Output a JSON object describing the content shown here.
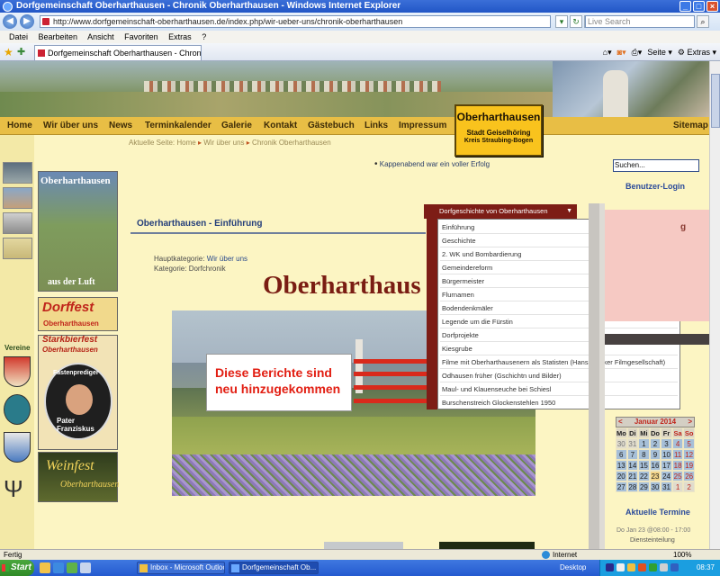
{
  "window": {
    "title": "Dorfgemeinschaft Oberharthausen - Chronik Oberharthausen - Windows Internet Explorer",
    "url": "http://www.dorfgemeinschaft-oberharthausen.de/index.php/wir-ueber-uns/chronik-oberharthausen",
    "live_search_placeholder": "Live Search",
    "tab_title": "Dorfgemeinschaft Oberharthausen - Chronik Oberhar...",
    "tools": {
      "seite": "Seite",
      "extras": "Extras"
    },
    "icons": [
      "ie-icon",
      "back-icon",
      "forward-icon",
      "refresh-icon",
      "stop-icon",
      "search-icon",
      "favorites-star-icon",
      "add-favorites-icon",
      "home-icon",
      "feeds-icon",
      "print-icon"
    ]
  },
  "menu": [
    "Datei",
    "Bearbeiten",
    "Ansicht",
    "Favoriten",
    "Extras",
    "?"
  ],
  "site": {
    "nav": [
      "Home",
      "Wir über uns",
      "News",
      "Terminkalender",
      "Galerie",
      "Kontakt",
      "Gästebuch",
      "Links",
      "Impressum"
    ],
    "sitemap": "Sitemap",
    "logo": {
      "line1": "Oberharthausen",
      "line2": "Stadt Geiselhöring",
      "line3": "Kreis Straubing-Bogen"
    },
    "breadcrumb": {
      "prefix": "Aktuelle Seite: ",
      "home": "Home",
      "level1": "Wir über uns",
      "level2": "Chronik Oberharthausen"
    },
    "news_item": "Kappenabend war ein voller Erfolg",
    "left": {
      "vereine": "Vereine"
    },
    "ads": {
      "luft_title": "Oberharthausen",
      "luft_sub": "aus der Luft",
      "dorffest_title": "Dorffest",
      "dorffest_sub": "Oberharthausen",
      "starkbier_title": "Starkbierfest",
      "starkbier_sub": "Oberharthausen",
      "fasten_top": "Fastenprediger",
      "fasten_bottom": "Pater Franziskus",
      "weinfest_title": "Weinfest",
      "weinfest_sub": "Oberharthausen"
    },
    "section_title": "Oberharthausen - Einführung",
    "hauptkategorie_label": "Hauptkategorie: ",
    "hauptkategorie_link": "Wir über uns",
    "kategorie": "Kategorie: Dorfchronik",
    "big_title": "Oberharthaus",
    "annotation": {
      "line1": "Diese Berichte sind",
      "line2": "neu hinzugekommen"
    },
    "dropdown": {
      "header": "Dorfgeschichte von Oberharthausen",
      "items": [
        "Einführung",
        "Geschichte",
        "2. WK und Bombardierung",
        "Gemeindereform",
        "Bürgermeister",
        "Flurnamen",
        "Bodendenkmäler",
        "Legende um die Fürstin",
        "Dorfprojekte",
        "Kiesgrube",
        "Filme mit Oberharthausenern als Statisten (Hans Wacker Filmgesellschaft)",
        "Odhausen früher (Gschichtn und Bilder)",
        "Maul- und Klauenseuche bei Schiesl",
        "Burschenstreich Glockenstehlen 1950"
      ]
    },
    "right": {
      "search_value": "Suchen...",
      "login": "Benutzer-Login",
      "pink_glyph": "g",
      "calendar": {
        "month": "Januar 2014",
        "prev": "<",
        "next": ">",
        "weekdays": [
          "Mo",
          "Di",
          "Mi",
          "Do",
          "Fr",
          "Sa",
          "So"
        ],
        "weeks": [
          [
            "30",
            "31",
            "1",
            "2",
            "3",
            "4",
            "5"
          ],
          [
            "6",
            "7",
            "8",
            "9",
            "10",
            "11",
            "12"
          ],
          [
            "13",
            "14",
            "15",
            "16",
            "17",
            "18",
            "19"
          ],
          [
            "20",
            "21",
            "22",
            "23",
            "24",
            "25",
            "26"
          ],
          [
            "27",
            "28",
            "29",
            "30",
            "31",
            "1",
            "2"
          ]
        ]
      },
      "termine": "Aktuelle Termine",
      "event_date": "Do Jan 23 @08:00 - 17:00",
      "event_title": "Diensteinteilung"
    }
  },
  "statusbar": {
    "ready": "Fertig",
    "zone": "Internet",
    "zoom": "100%"
  },
  "taskbar": {
    "start": "Start",
    "items": [
      "Inbox - Microsoft Outlook",
      "Dorfgemeinschaft Ob..."
    ],
    "desktop": "Desktop",
    "clock": "08:37"
  },
  "colors": {
    "page_bg": "#fcf5c3",
    "nav_bg": "#e8be45",
    "dropdown_header": "#7d1d16",
    "annotation_red": "#e21e12",
    "title_red": "#7a1d13",
    "link_blue": "#2a4a9a"
  }
}
